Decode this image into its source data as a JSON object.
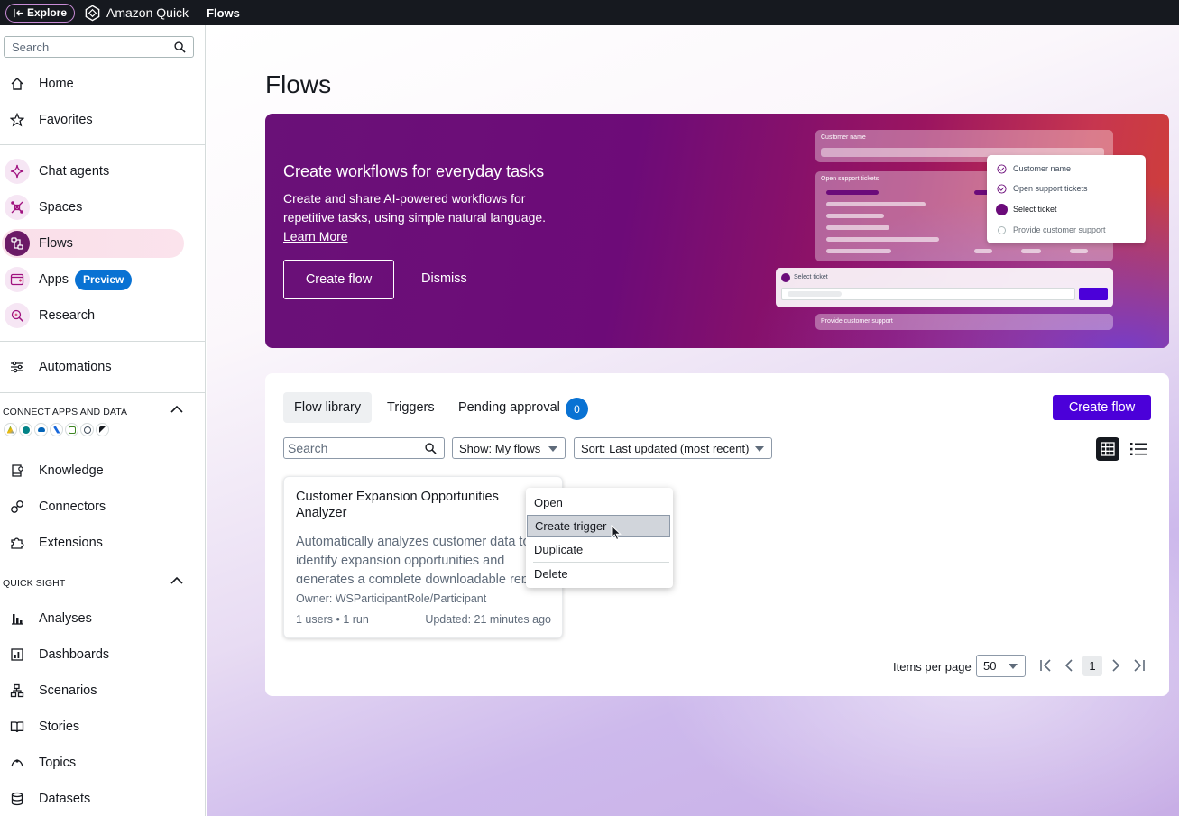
{
  "topbar": {
    "explore_label": "Explore",
    "brand": "Amazon Quick",
    "breadcrumb": "Flows"
  },
  "sidebar": {
    "search_placeholder": "Search",
    "items": {
      "home": "Home",
      "favorites": "Favorites",
      "chat_agents": "Chat agents",
      "spaces": "Spaces",
      "flows": "Flows",
      "apps": "Apps",
      "apps_badge": "Preview",
      "research": "Research",
      "automations": "Automations",
      "knowledge": "Knowledge",
      "connectors": "Connectors",
      "extensions": "Extensions",
      "analyses": "Analyses",
      "dashboards": "Dashboards",
      "scenarios": "Scenarios",
      "stories": "Stories",
      "topics": "Topics",
      "datasets": "Datasets"
    },
    "section_connect": "CONNECT APPS AND DATA",
    "section_quicksight": "QUICK SIGHT",
    "connector_icons": [
      "google-drive-icon",
      "sharepoint-icon",
      "onedrive-icon",
      "confluence-icon",
      "s3-icon",
      "web-icon",
      "zendesk-icon"
    ]
  },
  "page": {
    "title": "Flows"
  },
  "hero": {
    "title": "Create workflows for everyday tasks",
    "text": "Create and share AI-powered workflows for repetitive tasks, using simple natural language.",
    "learn_more": "Learn More",
    "create_label": "Create flow",
    "dismiss_label": "Dismiss",
    "illustration": {
      "customer_name": "Customer name",
      "open_tickets": "Open support tickets",
      "select_ticket": "Select ticket",
      "provide_support": "Provide customer support",
      "steps": [
        "Customer name",
        "Open support tickets",
        "Select ticket",
        "Provide customer support"
      ]
    }
  },
  "library": {
    "tabs": [
      "Flow library",
      "Triggers",
      "Pending approval"
    ],
    "pending_count": "0",
    "create_label": "Create flow",
    "search_placeholder": "Search",
    "show_filter": "Show: My flows",
    "sort_filter": "Sort: Last updated (most recent)",
    "flow": {
      "title": "Customer Expansion Opportunities Analyzer",
      "description": "Automatically analyzes customer data to identify expansion opportunities and generates a complete downloadable report",
      "owner": "Owner: WSParticipantRole/Participant",
      "stats": "1 users • 1 run",
      "updated": "Updated: 21 minutes ago"
    },
    "context_menu": [
      "Open",
      "Create trigger",
      "Duplicate",
      "Delete"
    ],
    "items_per_page_label": "Items per page",
    "items_per_page": "50",
    "current_page": "1"
  },
  "colors": {
    "topbar": "#16191f",
    "primary": "#4b00d9",
    "badge": "#0972d3",
    "hero_start": "#6a1178",
    "hero_end": "#d04036"
  }
}
